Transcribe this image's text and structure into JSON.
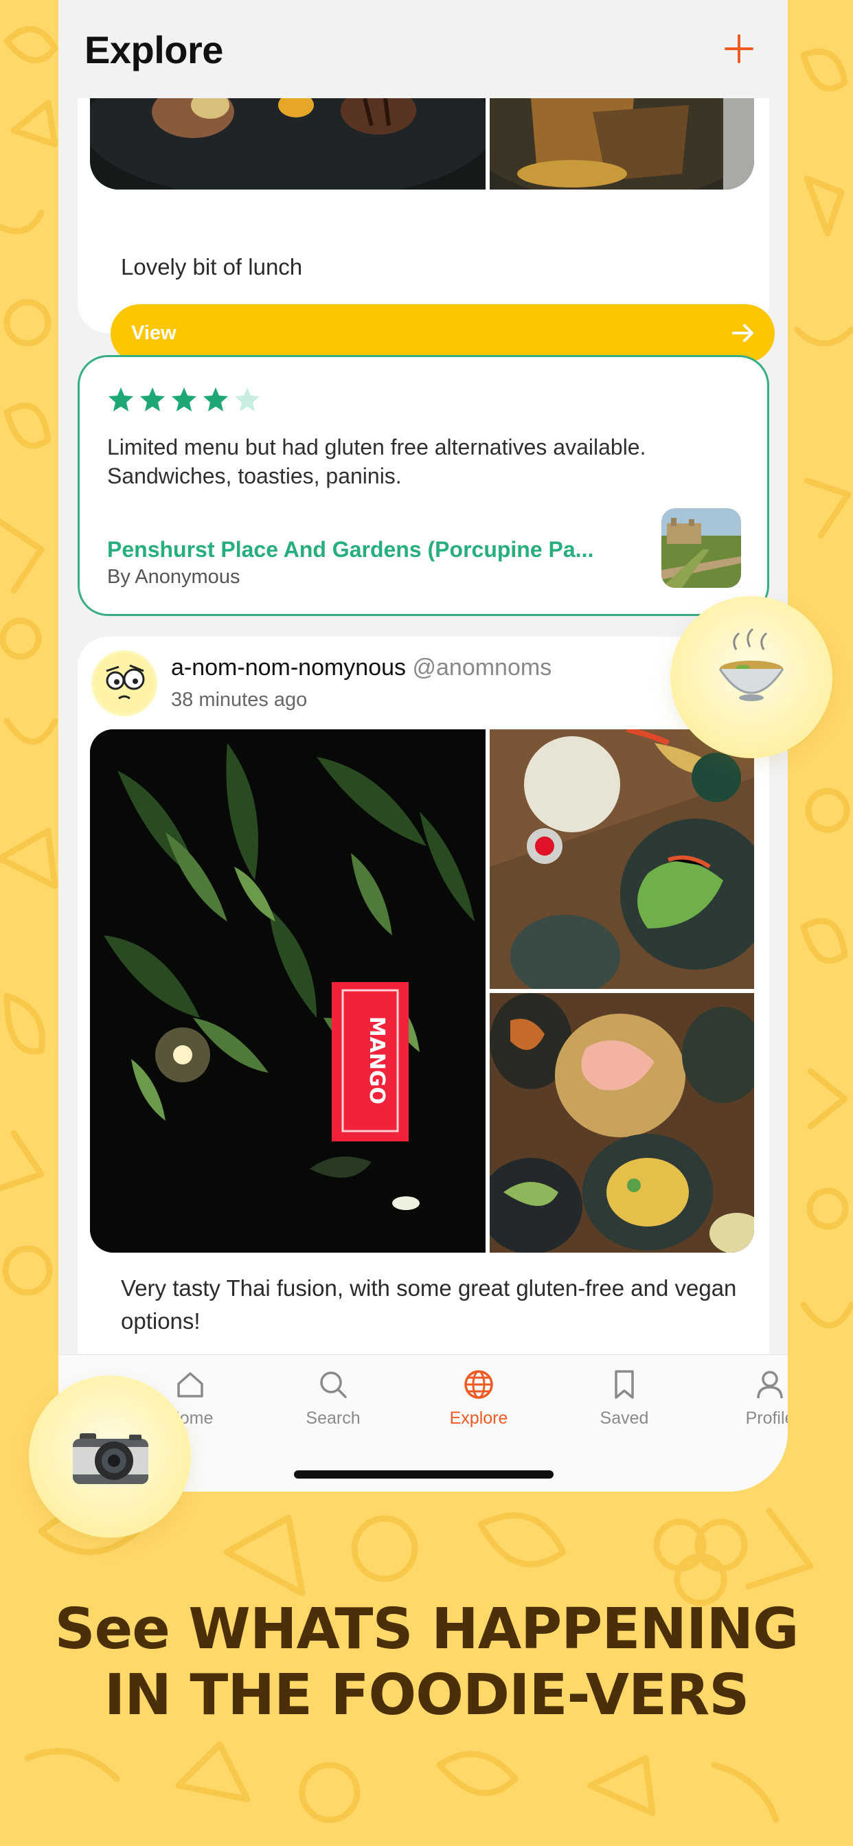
{
  "header": {
    "title": "Explore"
  },
  "card1": {
    "caption": "Lovely bit of lunch",
    "button_label": "View"
  },
  "review": {
    "rating": 4,
    "max_rating": 5,
    "text": "Limited menu but had gluten free alternatives available. Sandwiches, toasties, paninis.",
    "place": "Penshurst Place And Gardens (Porcupine Pa...",
    "author": "By Anonymous"
  },
  "post": {
    "display_name": "a-nom-nom-nomynous",
    "handle": "@anomnoms",
    "time": "38 minutes ago",
    "sign_text": "MANGO",
    "caption": "Very tasty Thai fusion, with some great gluten-free and vegan options!"
  },
  "tabs": [
    {
      "label": "Home",
      "icon": "home-icon",
      "active": false
    },
    {
      "label": "Search",
      "icon": "search-icon",
      "active": false
    },
    {
      "label": "Explore",
      "icon": "globe-icon",
      "active": true
    },
    {
      "label": "Saved",
      "icon": "bookmark-icon",
      "active": false
    },
    {
      "label": "Profile",
      "icon": "person-icon",
      "active": false
    }
  ],
  "tagline": {
    "line1": "See WHATS HAPPENING",
    "line2": "IN THE FOODIE-VERS"
  },
  "colors": {
    "background": "#ffd86a",
    "accent_orange": "#ee5a24",
    "button_yellow": "#fcc600",
    "review_green": "#27ae7c",
    "tagline_brown": "#4a2f08"
  }
}
